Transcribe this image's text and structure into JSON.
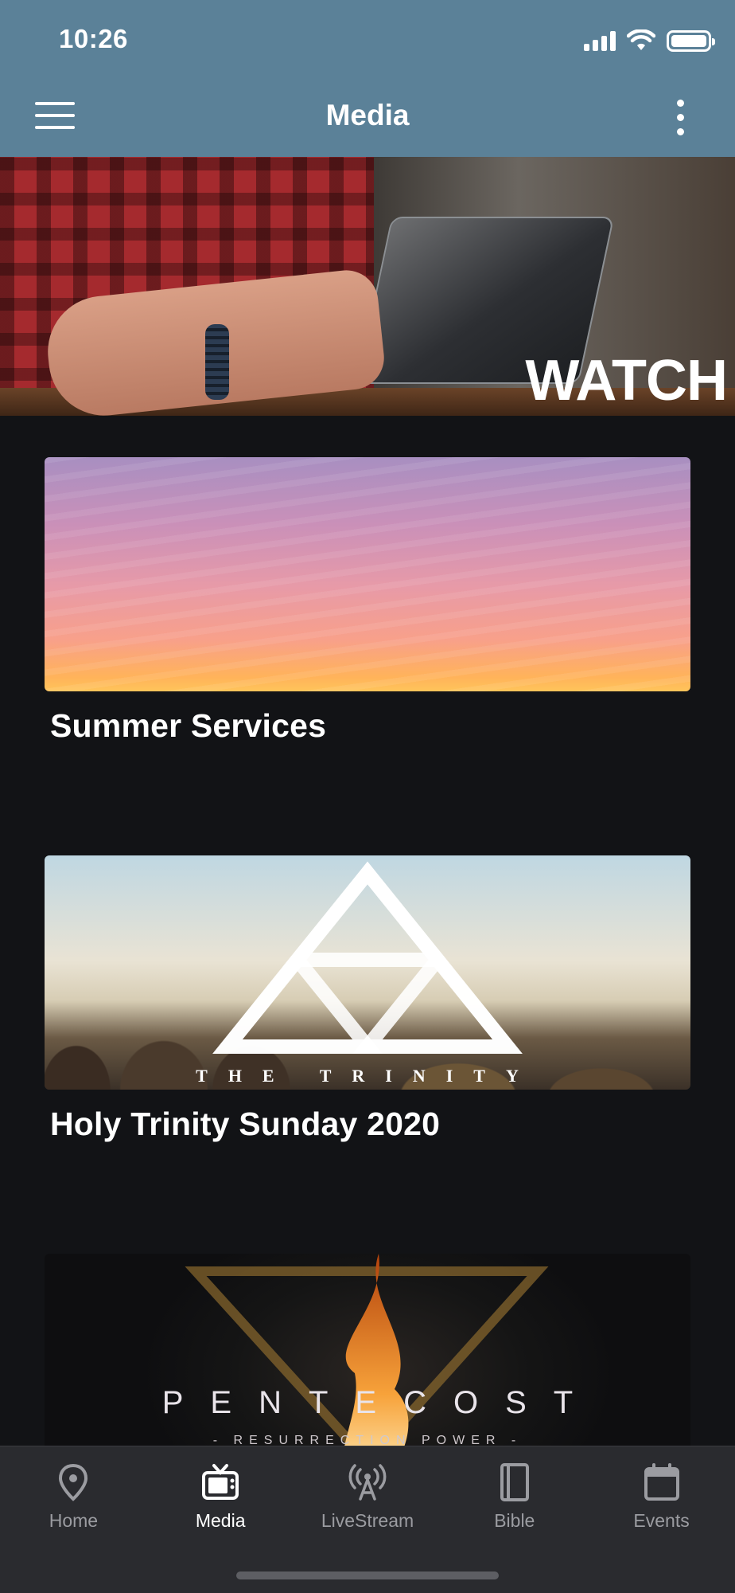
{
  "status_bar": {
    "time": "10:26"
  },
  "app_bar": {
    "title": "Media"
  },
  "hero": {
    "label": "WATCH"
  },
  "cards": [
    {
      "title": "Summer Services"
    },
    {
      "title": "Holy Trinity Sunday 2020",
      "image_caption": "THE TRINITY"
    },
    {
      "title": "",
      "image_caption": "PENTECOST",
      "image_subcaption": "- RESURRECTION POWER -"
    }
  ],
  "bottom_nav": {
    "items": [
      {
        "label": "Home",
        "icon": "map-pin-icon",
        "active": false
      },
      {
        "label": "Media",
        "icon": "tv-icon",
        "active": true
      },
      {
        "label": "LiveStream",
        "icon": "broadcast-tower-icon",
        "active": false
      },
      {
        "label": "Bible",
        "icon": "book-icon",
        "active": false
      },
      {
        "label": "Events",
        "icon": "calendar-icon",
        "active": false
      }
    ]
  },
  "colors": {
    "app_bar": "#5b8198",
    "background": "#121316",
    "nav_background": "#2a2b2f",
    "nav_active": "#ffffff",
    "nav_inactive": "#9b9ca1"
  }
}
